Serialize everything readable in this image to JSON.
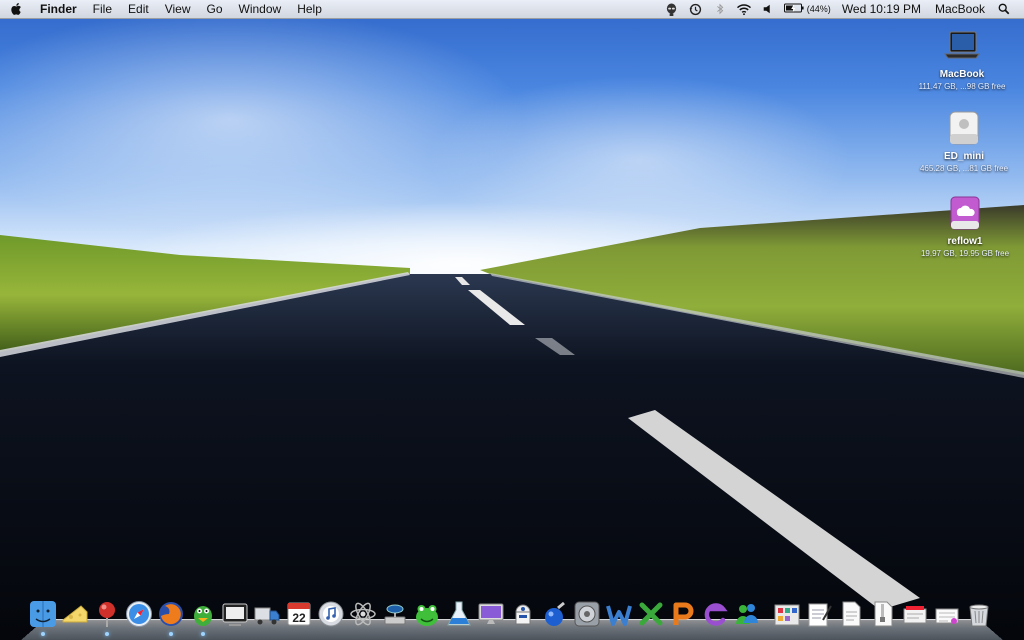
{
  "menubar": {
    "apple_icon": "apple-icon",
    "app_name": "Finder",
    "menus": [
      "File",
      "Edit",
      "View",
      "Go",
      "Window",
      "Help"
    ],
    "status": {
      "battery_percent": "(44%)",
      "clock": "Wed 10:19 PM",
      "user": "MacBook",
      "icons": [
        "alien-icon",
        "time-machine-icon",
        "bluetooth-icon",
        "wifi-icon",
        "volume-icon",
        "battery-icon",
        "spotlight-icon"
      ]
    }
  },
  "desktop": {
    "icons": [
      {
        "name": "MacBook",
        "info": "111.47 GB, ...98 GB free",
        "icon": "laptop-icon"
      },
      {
        "name": "ED_mini",
        "info": "465.28 GB, ...81 GB free",
        "icon": "external-drive-icon"
      },
      {
        "name": "reflow1",
        "info": "19.97 GB, 19.95 GB free",
        "icon": "cloud-drive-icon"
      }
    ]
  },
  "dock": {
    "calendar_day": "22",
    "items": [
      {
        "icon": "finder-icon",
        "running": true
      },
      {
        "icon": "cheese-icon",
        "running": false
      },
      {
        "icon": "pin-icon",
        "running": true
      },
      {
        "icon": "safari-icon",
        "running": false
      },
      {
        "icon": "firefox-icon",
        "running": true
      },
      {
        "icon": "adium-icon",
        "running": true
      },
      {
        "icon": "preview-icon",
        "running": false
      },
      {
        "icon": "transmit-icon",
        "running": false
      },
      {
        "icon": "calendar-icon",
        "running": false
      },
      {
        "icon": "itunes-icon",
        "running": false
      },
      {
        "icon": "atom-icon",
        "running": false
      },
      {
        "icon": "network-icon",
        "running": false
      },
      {
        "icon": "frog-icon",
        "running": false
      },
      {
        "icon": "flask-icon",
        "running": false
      },
      {
        "icon": "monitor-icon",
        "running": false
      },
      {
        "icon": "robot-icon",
        "running": false
      },
      {
        "icon": "potion-icon",
        "running": false
      },
      {
        "icon": "system-preferences-icon",
        "running": false
      },
      {
        "icon": "word-icon",
        "running": false
      },
      {
        "icon": "excel-icon",
        "running": false
      },
      {
        "icon": "powerpoint-icon",
        "running": false
      },
      {
        "icon": "entourage-icon",
        "running": false
      },
      {
        "icon": "messenger-icon",
        "running": false
      },
      {
        "icon": "applications-folder-icon",
        "running": false
      },
      {
        "icon": "notepad-icon",
        "running": false
      },
      {
        "icon": "document-icon",
        "running": false
      },
      {
        "icon": "zip-archive-icon",
        "running": false
      },
      {
        "icon": "stack-icon",
        "running": false
      },
      {
        "icon": "stack-icon-2",
        "running": false
      },
      {
        "icon": "trash-icon",
        "running": false
      }
    ]
  },
  "colors": {
    "running_indicator": "#9fd4ff",
    "menubar_text": "#111111",
    "desktop_label": "#ffffff"
  }
}
